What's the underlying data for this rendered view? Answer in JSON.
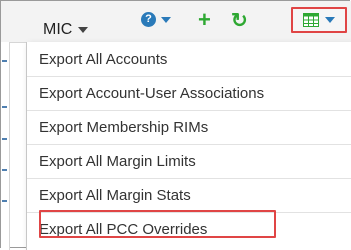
{
  "toolbar": {
    "mic_label": "MIC",
    "icons": {
      "help": "help-icon",
      "add": "plus-icon",
      "refresh": "refresh-icon",
      "export": "grid-export-icon"
    },
    "colors": {
      "accent_blue": "#2a7ab9",
      "accent_green": "#2ea832",
      "highlight_red": "#e04545"
    }
  },
  "export_menu": {
    "items": [
      {
        "label": "Export All Accounts"
      },
      {
        "label": "Export Account-User Associations"
      },
      {
        "label": "Export Membership RIMs"
      },
      {
        "label": "Export All Margin Limits"
      },
      {
        "label": "Export All Margin Stats"
      },
      {
        "label": "Export All PCC Overrides",
        "highlighted": true
      }
    ]
  }
}
